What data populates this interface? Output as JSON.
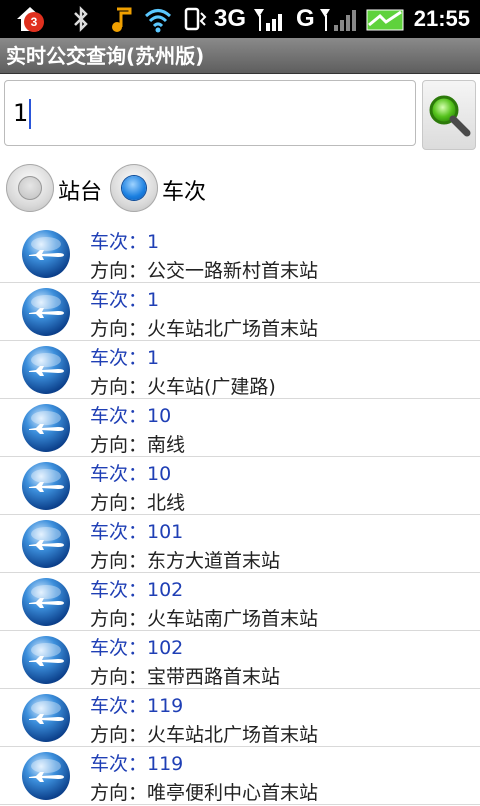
{
  "statusbar": {
    "notification_count": "3",
    "network_3g": "3G",
    "network_g": "G",
    "time": "21:55"
  },
  "app": {
    "title": "实时公交查询(苏州版)"
  },
  "search": {
    "value": "1"
  },
  "radios": [
    {
      "label": "站台",
      "checked": false
    },
    {
      "label": "车次",
      "checked": true
    }
  ],
  "list": {
    "items": [
      {
        "line": "车次：1",
        "direction": "方向：公交一路新村首末站"
      },
      {
        "line": "车次：1",
        "direction": "方向：火车站北广场首末站"
      },
      {
        "line": "车次：1",
        "direction": "方向：火车站(广建路)"
      },
      {
        "line": "车次：10",
        "direction": "方向：南线"
      },
      {
        "line": "车次：10",
        "direction": "方向：北线"
      },
      {
        "line": "车次：101",
        "direction": "方向：东方大道首末站"
      },
      {
        "line": "车次：102",
        "direction": "方向：火车站南广场首末站"
      },
      {
        "line": "车次：102",
        "direction": "方向：宝带西路首末站"
      },
      {
        "line": "车次：119",
        "direction": "方向：火车站北广场首末站"
      },
      {
        "line": "车次：119",
        "direction": "方向：唯亭便利中心首末站"
      }
    ]
  },
  "colors": {
    "accent": "#1f3fb5",
    "titlebar": "#6f6f6f",
    "radio_checked": "#1a7fe0"
  }
}
